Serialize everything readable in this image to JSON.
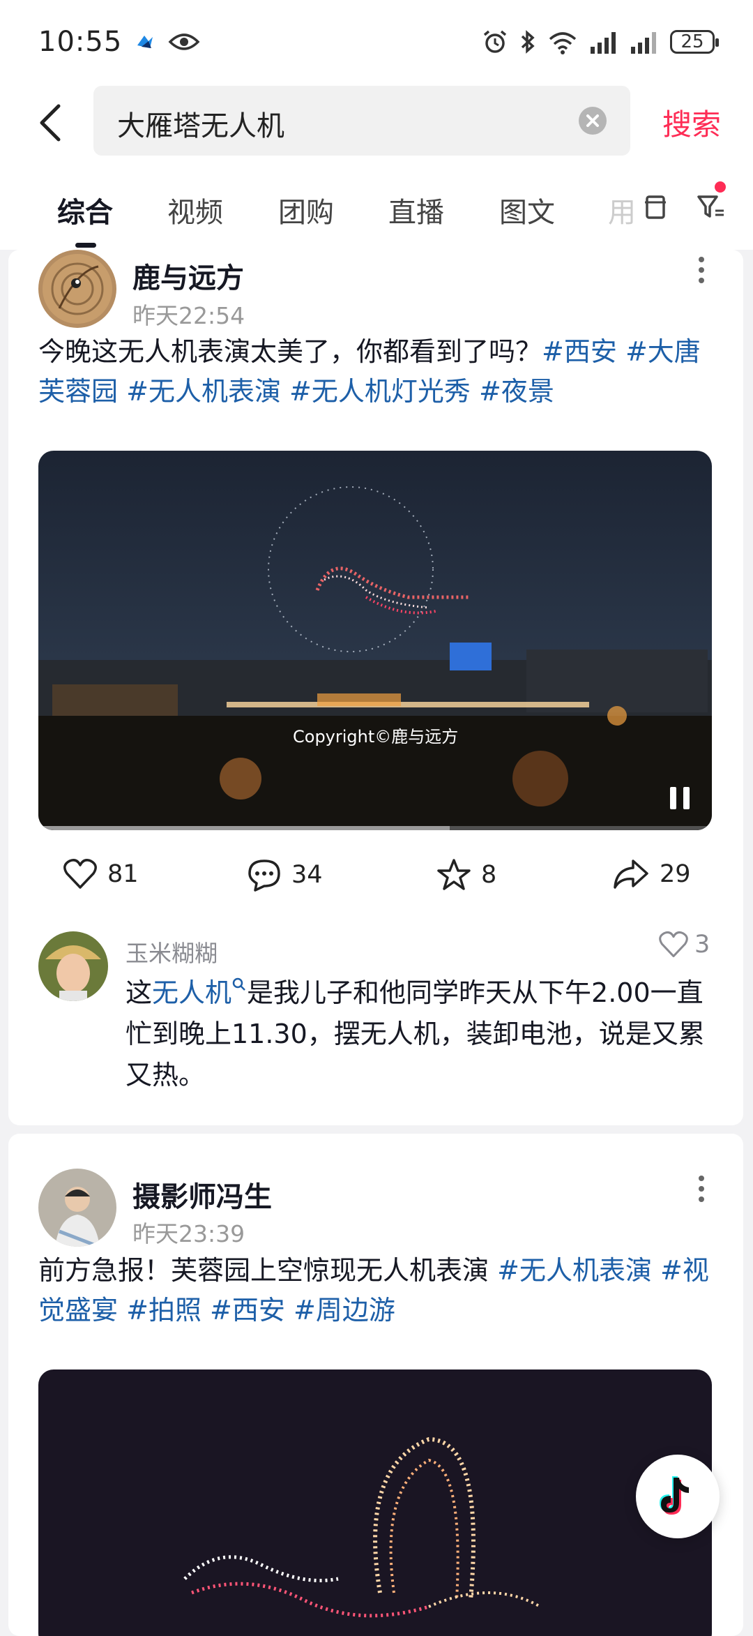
{
  "status_bar": {
    "time": "10:55",
    "battery": "25"
  },
  "search": {
    "query": "大雁塔无人机",
    "button_label": "搜索"
  },
  "tabs": [
    "综合",
    "视频",
    "团购",
    "直播",
    "图文",
    "用"
  ],
  "posts": [
    {
      "author": "鹿与远方",
      "time": "昨天22:54",
      "text": "今晚这无人机表演太美了，你都看到了吗？",
      "tags": [
        "#西安",
        "#大唐芙蓉园",
        "#无人机表演",
        "#无人机灯光秀",
        "#夜景"
      ],
      "video_watermark": "Copyright©鹿与远方",
      "video_progress": 0.61,
      "likes": "81",
      "comments": "34",
      "favorites": "8",
      "shares": "29",
      "top_comment": {
        "name": "玉米糊糊",
        "likes": "3",
        "text_before": "这",
        "keyword": "无人机",
        "text_after": "是我儿子和他同学昨天从下午2.00一直忙到晚上11.30，摆无人机，装卸电池，说是又累又热。"
      }
    },
    {
      "author": "摄影师冯生",
      "time": "昨天23:39",
      "text": "前方急报！芙蓉园上空惊现无人机表演",
      "tags": [
        "#无人机表演",
        "#视觉盛宴",
        "#拍照",
        "#西安",
        "#周边游"
      ]
    }
  ],
  "colors": {
    "accent": "#fe2c55",
    "hashtag": "#1d5fa8",
    "muted": "#999999"
  }
}
